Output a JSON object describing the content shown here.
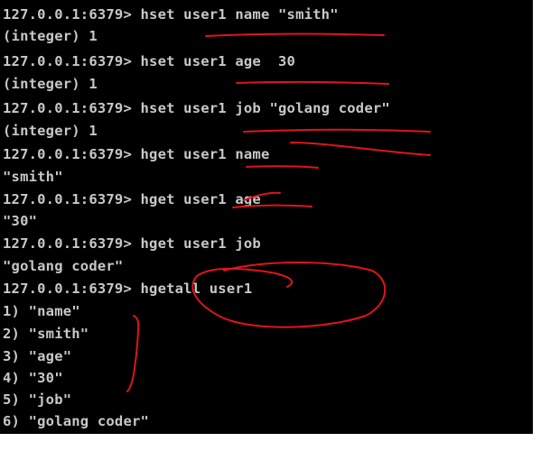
{
  "terminal": {
    "lines": [
      "127.0.0.1:6379> hset user1 name \"smith\"",
      "(integer) 1",
      "127.0.0.1:6379> hset user1 age  30",
      "(integer) 1",
      "127.0.0.1:6379> hset user1 job \"golang coder\"",
      "(integer) 1",
      "127.0.0.1:6379> hget user1 name",
      "\"smith\"",
      "127.0.0.1:6379> hget user1 age",
      "\"30\"",
      "127.0.0.1:6379> hget user1 job",
      "\"golang coder\"",
      "127.0.0.1:6379> hgetall user1",
      "1) \"name\"",
      "2) \"smith\"",
      "3) \"age\"",
      "4) \"30\"",
      "5) \"job\"",
      "6) \"golang coder\""
    ]
  },
  "colors": {
    "background": "#000000",
    "text": "#c8c8c8",
    "annotation": "#e0141a"
  }
}
